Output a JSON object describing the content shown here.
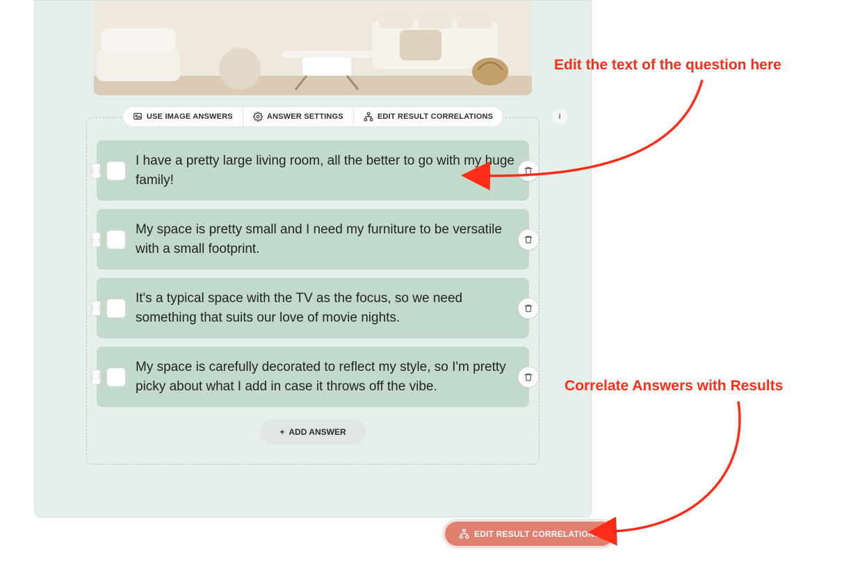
{
  "toolbar": {
    "use_image_answers": "USE IMAGE ANSWERS",
    "answer_settings": "ANSWER SETTINGS",
    "edit_result_correlations": "EDIT RESULT CORRELATIONS"
  },
  "answers": [
    {
      "text": "I have a pretty large living room, all the better to go with my huge family!"
    },
    {
      "text": "My space is pretty small and I need my furniture to be versatile with a small footprint."
    },
    {
      "text": "It's a typical space with the TV as the focus, so we need something that suits our love of movie nights."
    },
    {
      "text": "My space is carefully decorated to reflect my style, so I'm pretty picky about what I add in case it throws off the vibe."
    }
  ],
  "add_answer_label": "ADD ANSWER",
  "bottom_button_label": "EDIT RESULT CORRELATIONS",
  "callouts": {
    "edit_question": "Edit the text of the question here",
    "correlate": "Correlate Answers with Results"
  }
}
